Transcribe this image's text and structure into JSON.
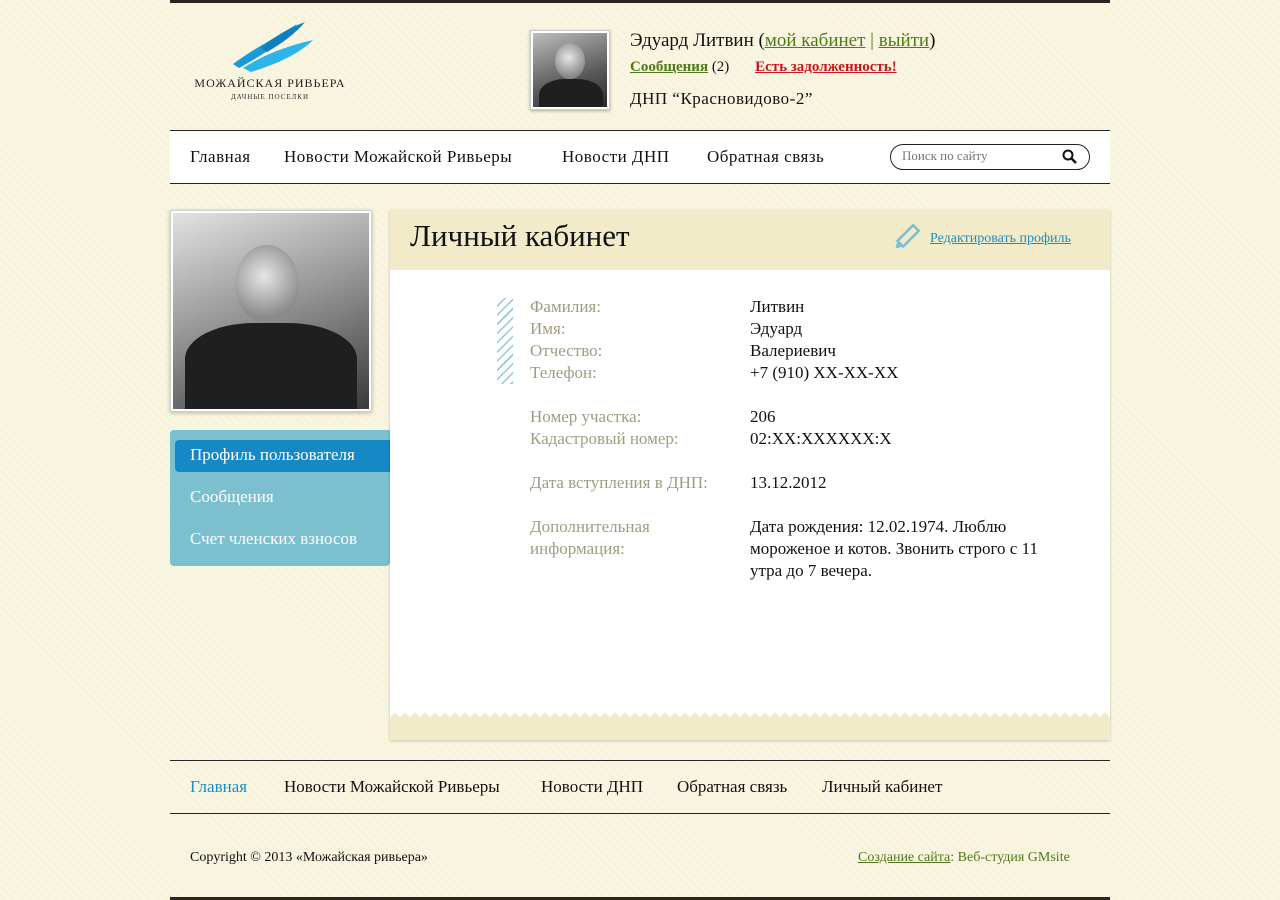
{
  "header": {
    "logo": {
      "name": "МОЖАЙСКАЯ РИВЬЕРА",
      "subtitle": "ДАЧНЫЕ ПОСЕЛКИ"
    },
    "user": {
      "name": "Эдуард Литвин",
      "open_paren": "(",
      "close_paren": ")",
      "cabinet_link": "мой кабинет",
      "separator": "|",
      "logout_link": "выйти",
      "messages_link": "Сообщения",
      "messages_count": "(2)",
      "debt_link": "Есть задолженность!",
      "dnp": "ДНП “Красновидово-2”"
    }
  },
  "nav": {
    "items": [
      "Главная",
      "Новости Можайской Ривьеры",
      "Новости ДНП",
      "Обратная связь"
    ],
    "search_placeholder": "Поиск по сайту"
  },
  "sidebar": {
    "items": [
      "Профиль пользователя",
      "Сообщения",
      "Счет членских взносов"
    ],
    "active_index": 0
  },
  "content": {
    "title": "Личный кабинет",
    "edit_link": "Редактировать профиль",
    "fields": [
      {
        "label": "Фамилия:",
        "value": "Литвин"
      },
      {
        "label": "Имя:",
        "value": "Эдуард"
      },
      {
        "label": "Отчество:",
        "value": "Валериевич"
      },
      {
        "label": "Телефон:",
        "value": "+7 (910) XX-XX-XX"
      },
      {
        "label": "Номер участка:",
        "value": "206"
      },
      {
        "label": "Кадастровый номер:",
        "value": "02:XX:XXXXXX:X"
      },
      {
        "label": "Дата вступления в ДНП:",
        "value": "13.12.2012"
      },
      {
        "label": "Дополнительная информация:",
        "value": "Дата рождения: 12.02.1974. Люблю мороженое и котов. Звонить строго с 11 утра до 7 вечера."
      }
    ]
  },
  "footer": {
    "nav": [
      "Главная",
      "Новости Можайской Ривьеры",
      "Новости ДНП",
      "Обратная связь",
      "Личный кабинет"
    ],
    "copyright": "Copyright © 2013 «Можайская ривьера»",
    "credit_link": "Создание сайта",
    "credit_rest": ": Веб-студия GMsite"
  },
  "colors": {
    "accent": "#1788c6",
    "sidebar": "#7cbfcf",
    "link_green": "#4f7a1a",
    "alert": "#c8171b"
  }
}
